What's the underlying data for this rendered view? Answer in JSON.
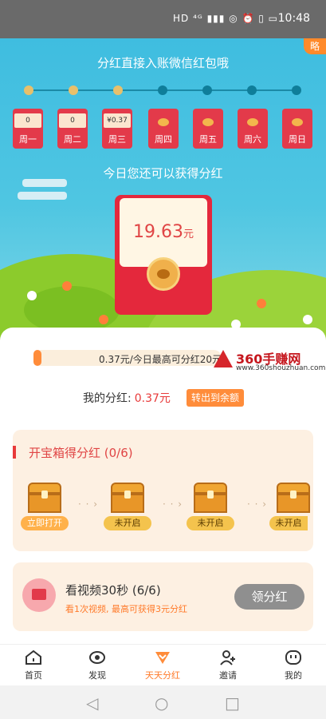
{
  "status_bar": {
    "icons": "HD ⁴ᴳ ▮▮▮ ◎ ⏰ ▯ ▭",
    "time": "10:48"
  },
  "hero": {
    "corner_tag": "略",
    "title": "分红直接入账微信红包哦",
    "days": [
      {
        "label": "周一",
        "amount": "0"
      },
      {
        "label": "周二",
        "amount": "0"
      },
      {
        "label": "周三",
        "amount": "¥0.37"
      },
      {
        "label": "周四",
        "amount": ""
      },
      {
        "label": "周五",
        "amount": ""
      },
      {
        "label": "周六",
        "amount": ""
      },
      {
        "label": "周日",
        "amount": ""
      }
    ],
    "subtitle": "今日您还可以获得分红",
    "envelope_value": "19.63",
    "envelope_unit": "元"
  },
  "progress": {
    "text": "0.37元/今日最高可分红20元",
    "fraction": 0.0185
  },
  "watermark": {
    "brand": "360手赚网",
    "url": "www.360shouzhuan.com"
  },
  "my_bonus": {
    "label": "我的分红:",
    "amount": "0.37元",
    "button": "转出到余额"
  },
  "treasure": {
    "title": "开宝箱得分红 (0/6)",
    "chests": [
      "立即打开",
      "未开启",
      "未开启",
      "未开启"
    ],
    "arrow": "· · ›"
  },
  "video": {
    "title": "看视频30秒 (6/6)",
    "subtitle": "看1次视频, 最高可获得3元分红",
    "button": "领分红"
  },
  "tabs": [
    {
      "label": "首页",
      "icon": "home-icon"
    },
    {
      "label": "发现",
      "icon": "discover-icon"
    },
    {
      "label": "天天分红",
      "icon": "daily-bonus-icon"
    },
    {
      "label": "邀请",
      "icon": "invite-icon"
    },
    {
      "label": "我的",
      "icon": "profile-icon"
    }
  ],
  "nav": {
    "back": "◁",
    "home": "○",
    "recent": "□"
  },
  "colors": {
    "accent": "#ff8c3a",
    "red": "#e4283c",
    "sky": "#3fbde0"
  }
}
